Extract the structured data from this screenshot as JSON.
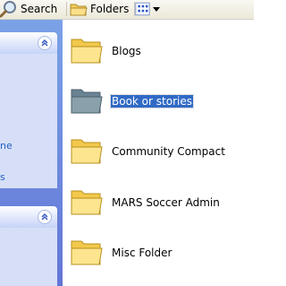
{
  "toolbar": {
    "search_label": "Search",
    "folders_label": "Folders"
  },
  "files": [
    {
      "name": "Blogs",
      "selected": false
    },
    {
      "name": "Book or stories",
      "selected": true
    },
    {
      "name": "Community Compact",
      "selected": false
    },
    {
      "name": "MARS Soccer Admin",
      "selected": false
    },
    {
      "name": "Misc Folder",
      "selected": false
    }
  ],
  "taskpane": {
    "link1": "ne",
    "link2": "s"
  },
  "icons": {
    "search": "magnifier-icon",
    "folders": "folder-icon",
    "views": "views-grid-icon",
    "collapse": "chevron-up-icon"
  },
  "colors": {
    "selection": "#316ac5",
    "taskpane": "#6f8fe0",
    "link": "#215dc6"
  }
}
